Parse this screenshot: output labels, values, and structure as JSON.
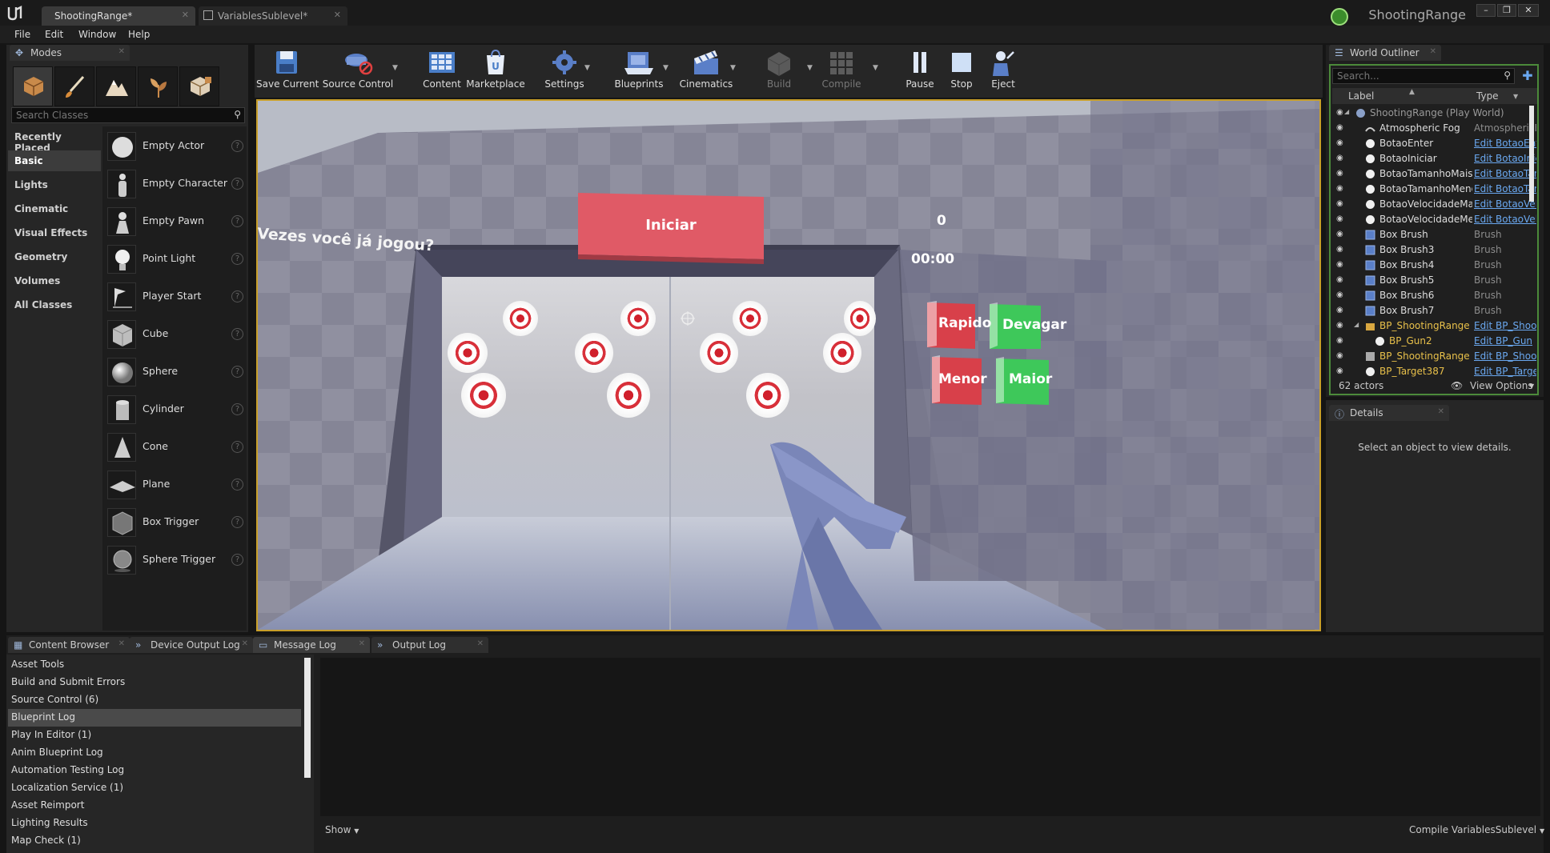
{
  "titlebar": {
    "tabs": [
      {
        "label": "ShootingRange*"
      },
      {
        "label": "VariablesSublevel*"
      }
    ],
    "project": "ShootingRange",
    "buttons": [
      "–",
      "❐",
      "✕"
    ]
  },
  "menu": [
    "File",
    "Edit",
    "Window",
    "Help"
  ],
  "modes": {
    "tab_label": "Modes",
    "search_placeholder": "Search Classes",
    "categories": [
      "Recently Placed",
      "Basic",
      "Lights",
      "Cinematic",
      "Visual Effects",
      "Geometry",
      "Volumes",
      "All Classes"
    ],
    "items": [
      "Empty Actor",
      "Empty Character",
      "Empty Pawn",
      "Point Light",
      "Player Start",
      "Cube",
      "Sphere",
      "Cylinder",
      "Cone",
      "Plane",
      "Box Trigger",
      "Sphere Trigger"
    ]
  },
  "toolbar": {
    "buttons": [
      "Save Current",
      "Source Control",
      "Content",
      "Marketplace",
      "Settings",
      "Blueprints",
      "Cinematics",
      "Build",
      "Compile",
      "Pause",
      "Stop",
      "Eject"
    ]
  },
  "viewport": {
    "start_button": "Iniciar",
    "question": "Vezes você já jogou?",
    "count": "0",
    "timer": "00:00",
    "btn_fast": "Rapido",
    "btn_slow": "Devagar",
    "btn_smaller": "Menor",
    "btn_bigger": "Maior"
  },
  "outliner": {
    "tab_label": "World Outliner",
    "search_placeholder": "Search...",
    "col_label": "Label",
    "col_type": "Type",
    "rows": [
      {
        "label": "ShootingRange (Play World)",
        "type": ""
      },
      {
        "label": "Atmospheric Fog",
        "type": "AtmosphericFog"
      },
      {
        "label": "BotaoEnter",
        "type": "Edit BotaoEnter"
      },
      {
        "label": "BotaoIniciar",
        "type": "Edit BotaoIniciar"
      },
      {
        "label": "BotaoTamanhoMais",
        "type": "Edit BotaoTamanhoMais"
      },
      {
        "label": "BotaoTamanhoMenos",
        "type": "Edit BotaoTamanhoMenos"
      },
      {
        "label": "BotaoVelocidadeMais",
        "type": "Edit BotaoVelocidadeMais"
      },
      {
        "label": "BotaoVelocidadeMenos",
        "type": "Edit BotaoVelocidadeMenos"
      },
      {
        "label": "Box Brush",
        "type": "Brush"
      },
      {
        "label": "Box Brush3",
        "type": "Brush"
      },
      {
        "label": "Box Brush4",
        "type": "Brush"
      },
      {
        "label": "Box Brush5",
        "type": "Brush"
      },
      {
        "label": "Box Brush6",
        "type": "Brush"
      },
      {
        "label": "Box Brush7",
        "type": "Brush"
      },
      {
        "label": "BP_ShootingRange",
        "type": "Edit BP_ShootingRange"
      },
      {
        "label": "BP_Gun2",
        "type": "Edit BP_Gun"
      },
      {
        "label": "BP_ShootingRange",
        "type": "Edit BP_ShootingRange"
      },
      {
        "label": "BP_Target387",
        "type": "Edit BP_Target"
      }
    ],
    "actor_count": "62 actors",
    "view_options": "View Options"
  },
  "details": {
    "tab_label": "Details",
    "empty_message": "Select an object to view details."
  },
  "bottom": {
    "tabs": [
      "Content Browser",
      "Device Output Log",
      "Message Log",
      "Output Log"
    ],
    "categories": [
      "Asset Tools",
      "Build and Submit Errors",
      "Source Control (6)",
      "Blueprint Log",
      "Play In Editor (1)",
      "Anim Blueprint Log",
      "Automation Testing Log",
      "Localization Service (1)",
      "Asset Reimport",
      "Lighting Results",
      "Map Check (1)"
    ],
    "show_label": "Show",
    "compile_label": "Compile VariablesSublevel"
  }
}
